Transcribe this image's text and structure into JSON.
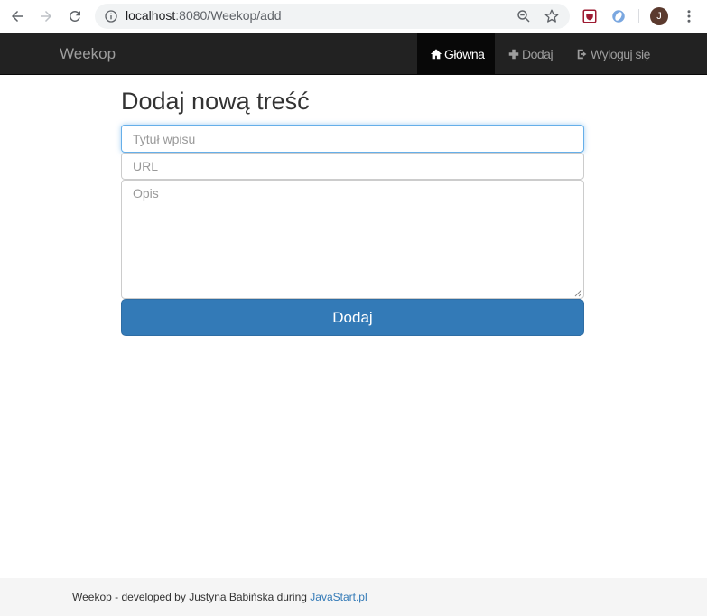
{
  "browser": {
    "url_host": "localhost",
    "url_rest": ":8080/Weekop/add",
    "avatar_letter": "J"
  },
  "navbar": {
    "brand": "Weekop",
    "items": [
      {
        "label": "Główna",
        "icon": "home-icon",
        "active": true
      },
      {
        "label": "Dodaj",
        "icon": "plus-icon",
        "active": false
      },
      {
        "label": "Wyloguj się",
        "icon": "log-out-icon",
        "active": false
      }
    ]
  },
  "form": {
    "heading": "Dodaj nową treść",
    "title_placeholder": "Tytuł wpisu",
    "url_placeholder": "URL",
    "description_placeholder": "Opis",
    "submit_label": "Dodaj"
  },
  "footer": {
    "text": "Weekop - developed by Justyna Babińska during ",
    "link_text": "JavaStart.pl"
  },
  "colors": {
    "navbar_bg": "#222222",
    "active_nav_bg": "#080808",
    "primary": "#337ab7",
    "footer_bg": "#f5f5f5"
  }
}
